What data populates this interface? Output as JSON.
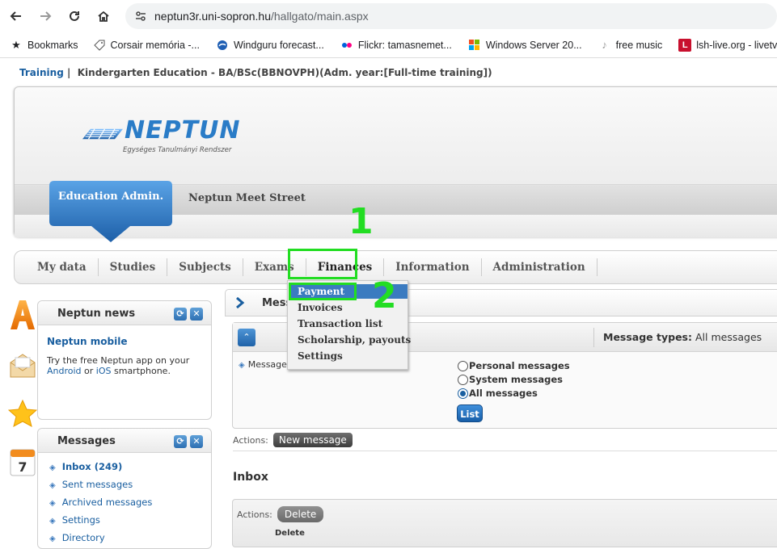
{
  "browser": {
    "url_host": "neptun3r.uni-sopron.hu",
    "url_path": "/hallgato/main.aspx",
    "bookmarks": [
      {
        "label": "Bookmarks",
        "icon": "star-icon"
      },
      {
        "label": "Corsair memória -...",
        "icon": "tag-icon"
      },
      {
        "label": "Windguru forecast...",
        "icon": "windguru-icon"
      },
      {
        "label": "Flickr: tamasnemet...",
        "icon": "flickr-icon"
      },
      {
        "label": "Windows Server 20...",
        "icon": "windows-icon"
      },
      {
        "label": "free music",
        "icon": "music-icon"
      },
      {
        "label": "lsh-live.org - livetv...",
        "icon": "lsh-icon"
      }
    ]
  },
  "breadcrumb": {
    "link": "Training",
    "separator": "|",
    "text": "Kindergarten Education - BA/BSc(BBNOVPH)(Adm. year:[Full-time training])"
  },
  "header": {
    "logo_text": "NEPTUN",
    "logo_sub": "Egységes Tanulmányi Rendszer",
    "tab_edu": "Education Admin.",
    "meet": "Neptun Meet Street"
  },
  "menu": [
    "My data",
    "Studies",
    "Subjects",
    "Exams",
    "Finances",
    "Information",
    "Administration"
  ],
  "annotations": {
    "step1": "1",
    "step2": "2",
    "color": "#22dd22"
  },
  "dropdown": [
    "Payment",
    "Invoices",
    "Transaction list",
    "Scholarship, payouts",
    "Settings"
  ],
  "news_panel": {
    "title": "Neptun news",
    "item_title": "Neptun mobile",
    "body_1": "Try the free Neptun app on your",
    "android": "Android",
    "or": "or",
    "ios": "iOS",
    "body_2": "smartphone."
  },
  "messages_panel": {
    "title": "Messages",
    "links": [
      "Inbox (249)",
      "Sent messages",
      "Archived messages",
      "Settings",
      "Directory"
    ]
  },
  "main": {
    "title": "Mess",
    "msg_types_label": "Message types:",
    "msg_types_value": "All messages",
    "filter_label": "Message ty",
    "radios": [
      "Personal messages",
      "System messages",
      "All messages"
    ],
    "list_button": "List",
    "actions_label": "Actions:",
    "new_message": "New message",
    "inbox_title": "Inbox",
    "delete_button": "Delete",
    "delete_col": "Delete"
  }
}
